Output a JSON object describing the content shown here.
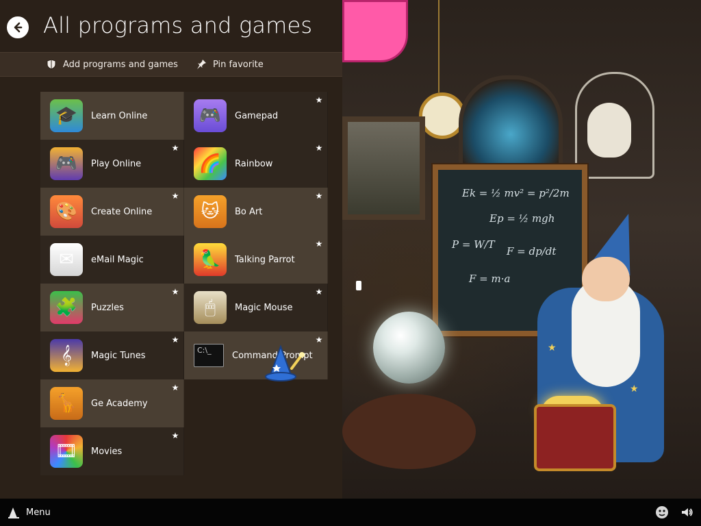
{
  "header": {
    "title": "All programs and games"
  },
  "toolbar": {
    "add_label": "Add programs and games",
    "pin_label": "Pin favorite"
  },
  "programs": [
    {
      "label": "Learn Online",
      "icon": "learn-online-icon",
      "col": 1
    },
    {
      "label": "Gamepad",
      "icon": "gamepad-icon",
      "col": 2
    },
    {
      "label": "Play Online",
      "icon": "play-online-icon",
      "col": 1
    },
    {
      "label": "Rainbow",
      "icon": "rainbow-icon",
      "col": 2
    },
    {
      "label": "Create Online",
      "icon": "create-online-icon",
      "col": 1
    },
    {
      "label": "Bo Art",
      "icon": "bo-art-icon",
      "col": 2
    },
    {
      "label": "eMail Magic",
      "icon": "email-magic-icon",
      "col": 1
    },
    {
      "label": "Talking Parrot",
      "icon": "talking-parrot-icon",
      "col": 2
    },
    {
      "label": "Puzzles",
      "icon": "puzzles-icon",
      "col": 1
    },
    {
      "label": "Magic Mouse",
      "icon": "magic-mouse-icon",
      "col": 2
    },
    {
      "label": "Magic Tunes",
      "icon": "magic-tunes-icon",
      "col": 1
    },
    {
      "label": "Command Prompt",
      "icon": "command-prompt-icon",
      "col": 2
    },
    {
      "label": "Ge Academy",
      "icon": "ge-academy-icon",
      "col": 1
    },
    {
      "label": "Movies",
      "icon": "movies-icon",
      "col": 1
    }
  ],
  "taskbar": {
    "menu_label": "Menu"
  },
  "colors": {
    "panel_bg": "#2b2118",
    "tile_bg": "#3f3529",
    "accent_pink": "#ff5aa8",
    "board_bg": "#1f2b2e"
  },
  "board": {
    "eq1": "Ek = ½ mv² = p²/2m",
    "eq2": "Ep = ½ mgh",
    "eq3": "P = W/T",
    "eq4": "F = dp/dt",
    "eq5": "F = m·a"
  }
}
